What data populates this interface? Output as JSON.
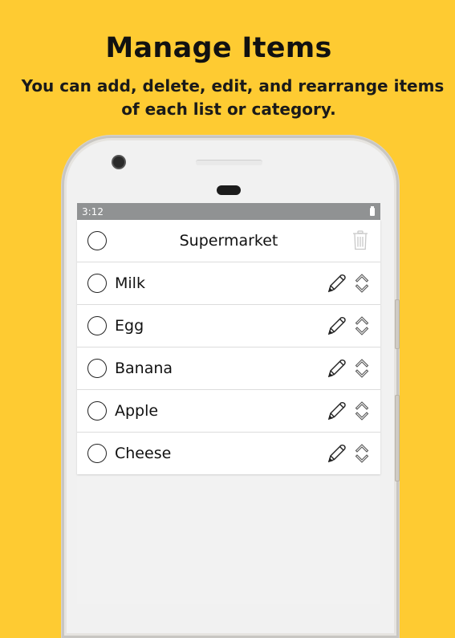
{
  "promo": {
    "headline": "Manage Items",
    "subtitle_line1": "You can add, delete, edit, and rearrange items",
    "subtitle_line2": "of each list or category."
  },
  "status_bar": {
    "time": "3:12",
    "battery_icon": "battery-icon"
  },
  "list_header": {
    "title": "Supermarket",
    "select_all_icon": "radio-circle-icon",
    "delete_icon": "trash-icon"
  },
  "items": [
    {
      "label": "Milk",
      "checked": false
    },
    {
      "label": "Egg",
      "checked": false
    },
    {
      "label": "Banana",
      "checked": false
    },
    {
      "label": "Apple",
      "checked": false
    },
    {
      "label": "Cheese",
      "checked": false
    }
  ],
  "item_icons": {
    "edit": "pencil-icon",
    "reorder": "reorder-chevrons-icon"
  },
  "colors": {
    "background": "#FECB32",
    "status_bar": "#909293",
    "screen_bg": "#F2F2F2",
    "trash_disabled": "#C8C8C8"
  }
}
